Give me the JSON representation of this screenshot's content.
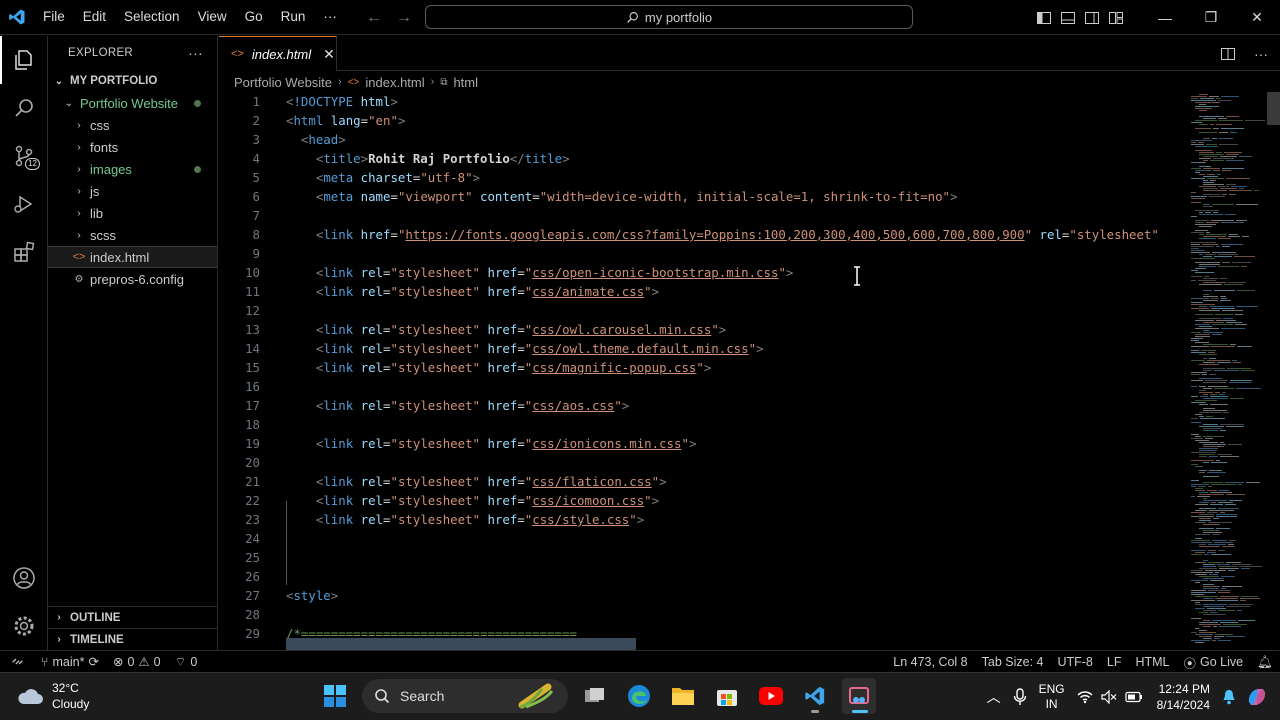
{
  "titlebar": {
    "menu": [
      "File",
      "Edit",
      "Selection",
      "View",
      "Go",
      "Run",
      "···"
    ],
    "command_center": "my portfolio"
  },
  "activity_bar": {
    "items": [
      "explorer-icon",
      "search-icon",
      "source-control-icon",
      "run-debug-icon",
      "extensions-icon"
    ],
    "source_control_badge": "12",
    "bottom": [
      "account-icon",
      "settings-gear-icon"
    ]
  },
  "sidebar": {
    "title": "EXPLORER",
    "more": "···",
    "workspace": "MY PORTFOLIO",
    "root_folder": "Portfolio Website",
    "items": [
      {
        "label": "css",
        "type": "folder"
      },
      {
        "label": "fonts",
        "type": "folder"
      },
      {
        "label": "images",
        "type": "folder"
      },
      {
        "label": "js",
        "type": "folder"
      },
      {
        "label": "lib",
        "type": "folder"
      },
      {
        "label": "scss",
        "type": "folder"
      },
      {
        "label": "index.html",
        "type": "file"
      },
      {
        "label": "prepros-6.config",
        "type": "file"
      }
    ],
    "outline": "OUTLINE",
    "timeline": "TIMELINE"
  },
  "editor": {
    "tab": {
      "name": "index.html",
      "close": "✕"
    },
    "breadcrumb": [
      "Portfolio Website",
      "index.html",
      "html"
    ],
    "lines": [
      {
        "n": "1"
      },
      {
        "n": "2"
      },
      {
        "n": "3"
      },
      {
        "n": "4"
      },
      {
        "n": "5"
      },
      {
        "n": "6"
      },
      {
        "n": "7"
      },
      {
        "n": "8"
      },
      {
        "n": "9"
      },
      {
        "n": "10"
      },
      {
        "n": "11"
      },
      {
        "n": "12"
      },
      {
        "n": "13"
      },
      {
        "n": "14"
      },
      {
        "n": "15"
      },
      {
        "n": "16"
      },
      {
        "n": "17"
      },
      {
        "n": "18"
      },
      {
        "n": "19"
      },
      {
        "n": "20"
      },
      {
        "n": "21"
      },
      {
        "n": "22"
      },
      {
        "n": "23"
      },
      {
        "n": "24"
      },
      {
        "n": "25"
      },
      {
        "n": "26"
      },
      {
        "n": "27"
      },
      {
        "n": "28"
      },
      {
        "n": "29"
      }
    ],
    "code": {
      "doctype_kw": "!DOCTYPE",
      "doctype_val": "html",
      "html": "html",
      "lang_attr": "lang",
      "lang_val": "\"en\"",
      "head": "head",
      "title_tag": "title",
      "title_text": "Rohit Raj Portfolio",
      "meta": "meta",
      "charset_attr": "charset",
      "charset_val": "\"utf-8\"",
      "name_attr": "name",
      "viewport_val": "\"viewport\"",
      "content_attr": "content",
      "content_val": "\"width=device-width, initial-scale=1, shrink-to-fit=no\"",
      "link": "link",
      "href_attr": "href",
      "rel_attr": "rel",
      "stylesheet_val": "\"stylesheet\"",
      "fonts_url": "https://fonts.googleapis.com/css?family=Poppins:100,200,300,400,500,600,700,800,900",
      "css_files": [
        "css/open-iconic-bootstrap.min.css",
        "css/animate.css",
        "css/owl.carousel.min.css",
        "css/owl.theme.default.min.css",
        "css/magnific-popup.css",
        "css/aos.css",
        "css/ionicons.min.css",
        "css/flaticon.css",
        "css/icomoon.css",
        "css/style.css"
      ],
      "style": "style",
      "comment": "/*====================================="
    }
  },
  "statusbar": {
    "branch": "main*",
    "errors": "0",
    "warnings": "0",
    "ports": "0",
    "position": "Ln 473, Col 8",
    "tab_size": "Tab Size: 4",
    "encoding": "UTF-8",
    "eol": "LF",
    "language": "HTML",
    "go_live": "Go Live"
  },
  "taskbar": {
    "weather_temp": "32°C",
    "weather_desc": "Cloudy",
    "search": "Search",
    "lang_top": "ENG",
    "lang_bottom": "IN",
    "time": "12:24 PM",
    "date": "8/14/2024"
  },
  "colors": {
    "accent_tab": "#e07b2b",
    "git_green": "#73c991",
    "keyword": "#569cd6",
    "attribute": "#9cdcfe",
    "string": "#ce9178"
  }
}
